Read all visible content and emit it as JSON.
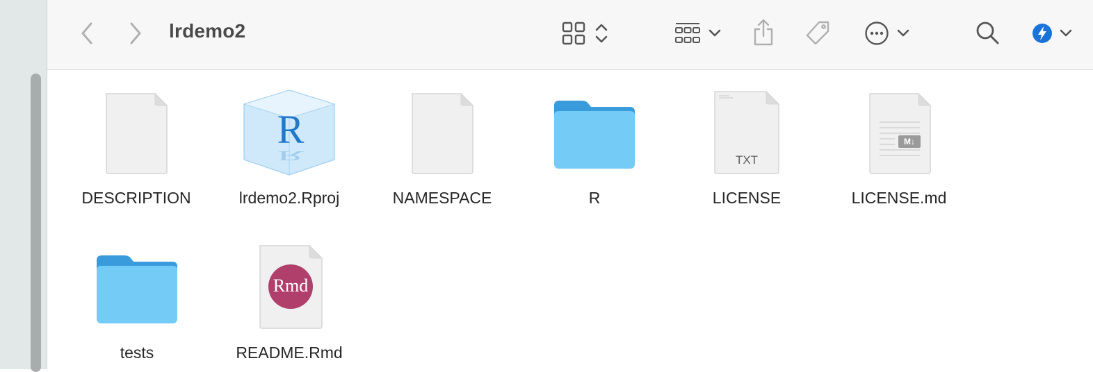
{
  "window": {
    "title": "lrdemo2"
  },
  "colors": {
    "folder_body": "#74cbf6",
    "folder_tab": "#3a9bdc",
    "accent_blue": "#1a73d9",
    "rmd_badge": "#b03f6c"
  },
  "toolbar": {
    "icons": [
      "back-icon",
      "forward-icon",
      "icon-view-icon",
      "group-icon",
      "share-icon",
      "tag-icon",
      "more-icon",
      "search-icon",
      "account-icon"
    ]
  },
  "files": [
    {
      "name": "DESCRIPTION",
      "kind": "document"
    },
    {
      "name": "lrdemo2.Rproj",
      "kind": "rproj"
    },
    {
      "name": "NAMESPACE",
      "kind": "document"
    },
    {
      "name": "R",
      "kind": "folder"
    },
    {
      "name": "LICENSE",
      "kind": "txt",
      "badge": "TXT"
    },
    {
      "name": "LICENSE.md",
      "kind": "markdown",
      "badge": "M↓"
    },
    {
      "name": "tests",
      "kind": "folder"
    },
    {
      "name": "README.Rmd",
      "kind": "rmd",
      "badge": "Rmd"
    }
  ]
}
